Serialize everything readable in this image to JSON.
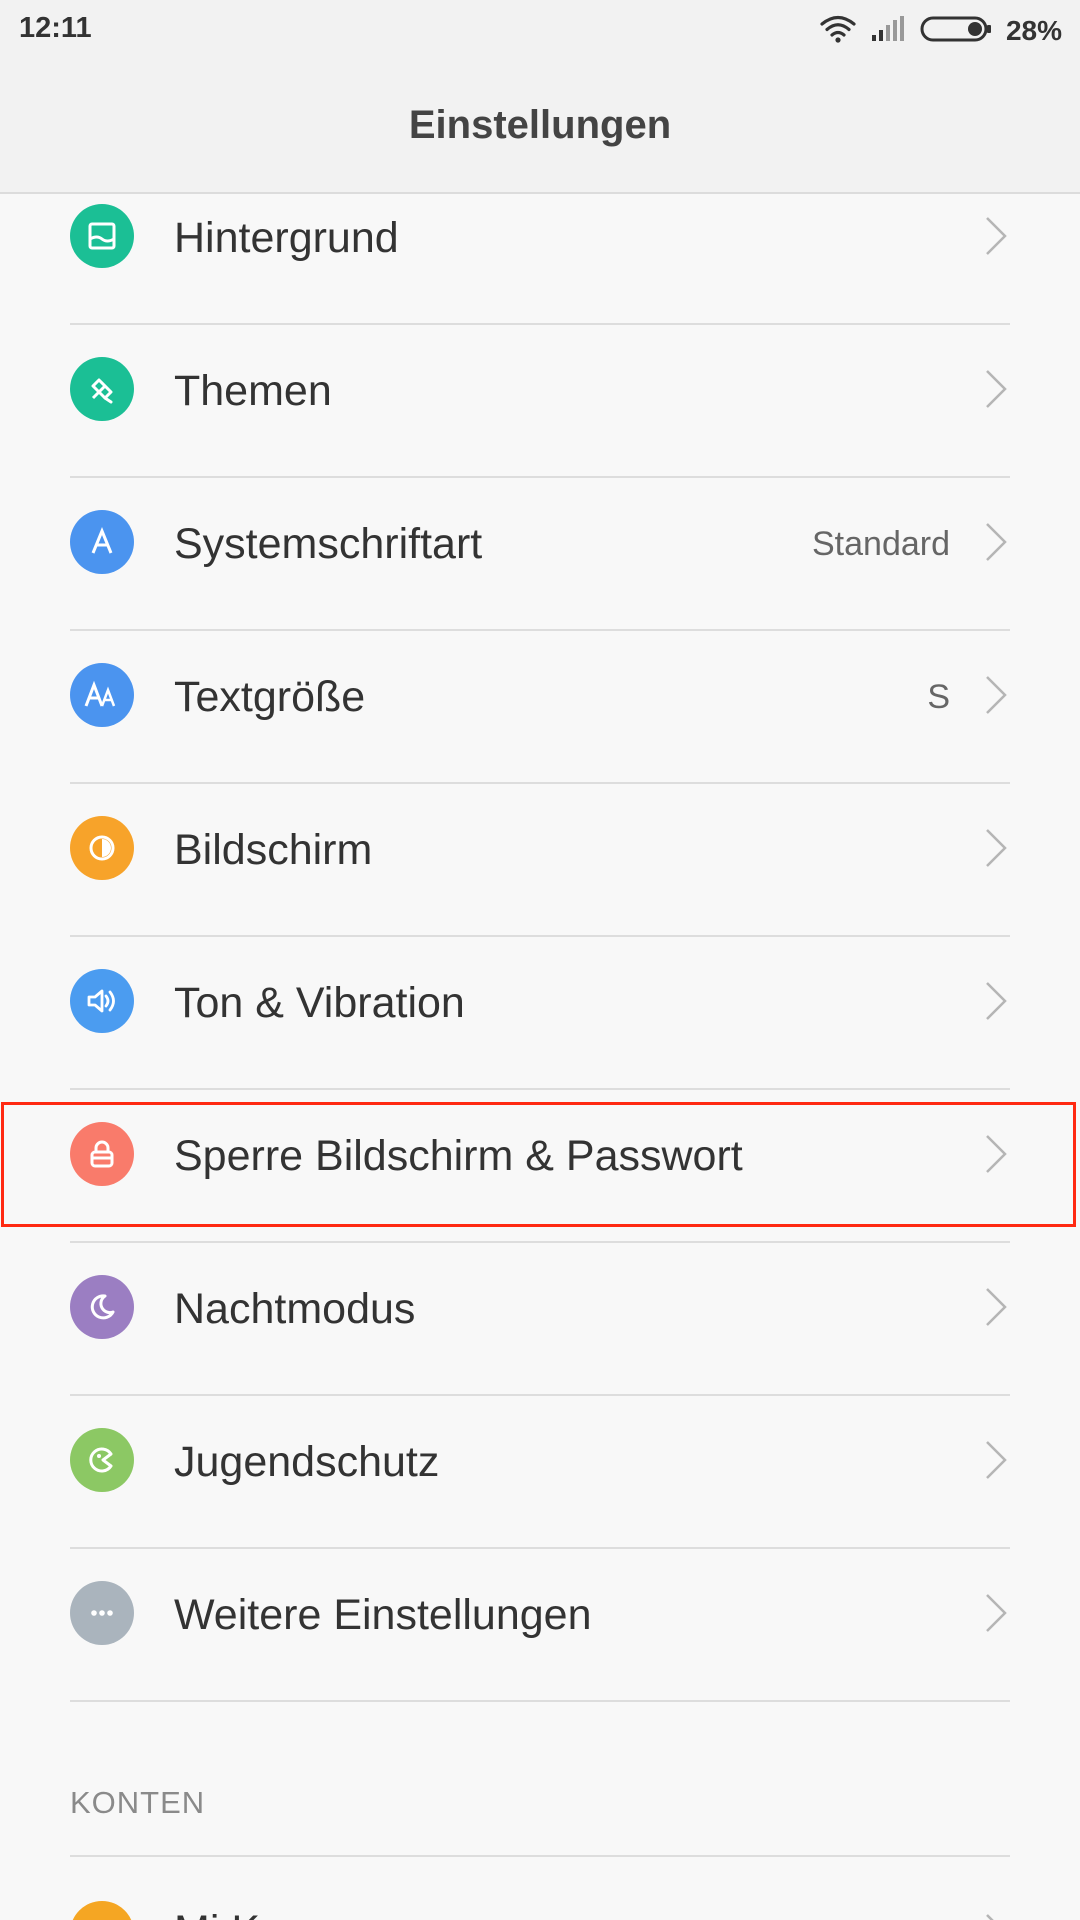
{
  "status_bar": {
    "time": "12:11",
    "battery": "28%",
    "icons": [
      "wifi-icon",
      "signal-icon",
      "battery-icon"
    ]
  },
  "header": {
    "title": "Einstellungen"
  },
  "items": [
    {
      "label": "Hintergrund",
      "value": "",
      "icon": "wallpaper-icon",
      "color": "#1bbf95"
    },
    {
      "label": "Themen",
      "value": "",
      "icon": "brush-icon",
      "color": "#1bbf95"
    },
    {
      "label": "Systemschriftart",
      "value": "Standard",
      "icon": "font-icon",
      "color": "#4b94ef"
    },
    {
      "label": "Textgröße",
      "value": "S",
      "icon": "text-size-icon",
      "color": "#4b94ef"
    },
    {
      "label": "Bildschirm",
      "value": "",
      "icon": "display-icon",
      "color": "#f7a32a"
    },
    {
      "label": "Ton & Vibration",
      "value": "",
      "icon": "speaker-icon",
      "color": "#4b9cf0"
    },
    {
      "label": "Sperre Bildschirm & Passwort",
      "value": "",
      "icon": "lock-icon",
      "color": "#f97b6b"
    },
    {
      "label": "Nachtmodus",
      "value": "",
      "icon": "moon-icon",
      "color": "#9b7ec2"
    },
    {
      "label": "Jugendschutz",
      "value": "",
      "icon": "child-icon",
      "color": "#8cc864"
    },
    {
      "label": "Weitere Einstellungen",
      "value": "",
      "icon": "more-icon",
      "color": "#aab4bd"
    }
  ],
  "section": {
    "title": "KONTEN"
  },
  "partial_item": {
    "label": "Mi K",
    "icon": "mi-account-icon",
    "color": "#f5a623"
  },
  "highlight_color": "#ff2a12"
}
